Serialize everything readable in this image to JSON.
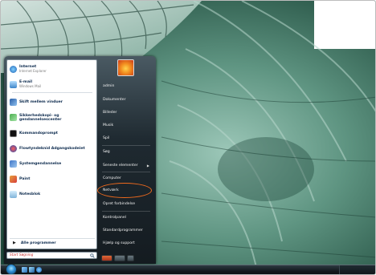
{
  "start_menu": {
    "pinned": [
      {
        "title": "Internet",
        "subtitle": "Internet Explorer",
        "icon": "internet-explorer-icon"
      },
      {
        "title": "E-mail",
        "subtitle": "Windows Mail",
        "icon": "mail-icon"
      }
    ],
    "recent": [
      {
        "title": "Skift mellem vinduer",
        "icon": "switch-windows-icon"
      },
      {
        "title": "Sikkerhedskopi- og gendannelsescenter",
        "icon": "backup-icon"
      },
      {
        "title": "Kommandoprompt",
        "icon": "command-prompt-icon"
      },
      {
        "title": "Flowtyndeknid Adgangskodeiet",
        "icon": "help-icon"
      },
      {
        "title": "Systemgendannelse",
        "icon": "system-restore-icon"
      },
      {
        "title": "Paint",
        "icon": "paint-icon"
      },
      {
        "title": "Notesblok",
        "icon": "notepad-icon"
      }
    ],
    "all_programs": "Alle programmer",
    "search_placeholder": "Start Søgning",
    "right_items": [
      {
        "label": "admin"
      },
      {
        "label": "Dokumenter"
      },
      {
        "label": "Billeder"
      },
      {
        "label": "Musik"
      },
      {
        "label": "Spil"
      },
      {
        "label": "Søg"
      },
      {
        "label": "Seneste elementer",
        "submenu": true
      },
      {
        "label": "Computer"
      },
      {
        "label": "Netværk"
      },
      {
        "label": "Opret forbindelse"
      },
      {
        "label": "Kontrolpanel"
      },
      {
        "label": "Standardprogrammer"
      },
      {
        "label": "Hjælp og support"
      }
    ]
  },
  "colors": {
    "highlight_ring": "#ef6a1d",
    "wallpaper_green": "#2f6150"
  }
}
